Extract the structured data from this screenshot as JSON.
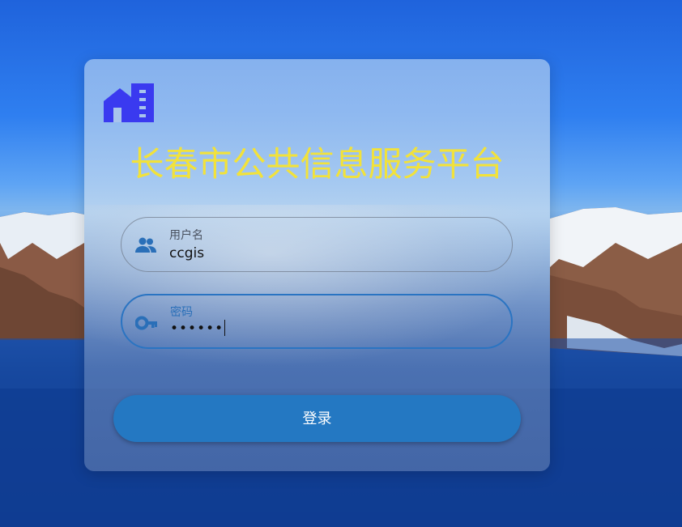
{
  "app": {
    "title": "长春市公共信息服务平台"
  },
  "login_form": {
    "username": {
      "label": "用户名",
      "value": "ccgis",
      "icon": "users-icon"
    },
    "password": {
      "label": "密码",
      "value": "••••••",
      "icon": "key-icon"
    },
    "submit_label": "登录"
  },
  "colors": {
    "title": "#f2e23a",
    "accent": "#2478c2",
    "logo": "#3a3af0"
  }
}
